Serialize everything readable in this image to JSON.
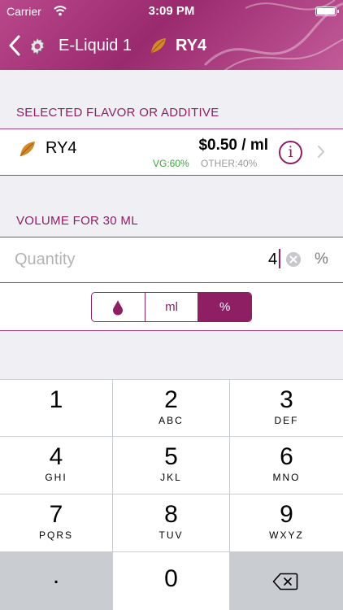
{
  "status_bar": {
    "carrier": "Carrier",
    "time": "3:09 PM"
  },
  "nav": {
    "back_label": "E-Liquid 1",
    "title": "RY4"
  },
  "selected_section": {
    "header": "SELECTED FLAVOR OR ADDITIVE",
    "flavor": {
      "name": "RY4",
      "price": "$0.50 / ml",
      "vg": "VG:60%",
      "other": "OTHER:40%",
      "info_glyph": "i"
    }
  },
  "volume_section": {
    "header": "VOLUME FOR 30 ML",
    "quantity": {
      "placeholder": "Quantity",
      "value": "4",
      "unit": "%"
    },
    "segments": [
      {
        "label": "",
        "icon": "drop-icon",
        "active": false
      },
      {
        "label": "ml",
        "active": false
      },
      {
        "label": "%",
        "active": true
      }
    ]
  },
  "keypad": {
    "keys": [
      {
        "digit": "1",
        "letters": ""
      },
      {
        "digit": "2",
        "letters": "ABC"
      },
      {
        "digit": "3",
        "letters": "DEF"
      },
      {
        "digit": "4",
        "letters": "GHI"
      },
      {
        "digit": "5",
        "letters": "JKL"
      },
      {
        "digit": "6",
        "letters": "MNO"
      },
      {
        "digit": "7",
        "letters": "PQRS"
      },
      {
        "digit": "8",
        "letters": "TUV"
      },
      {
        "digit": "9",
        "letters": "WXYZ"
      }
    ],
    "dot": ".",
    "zero": "0"
  },
  "colors": {
    "accent": "#8e1f63",
    "header": "#a8387c",
    "vg": "#3aa63a",
    "other": "#9a9a9a"
  }
}
